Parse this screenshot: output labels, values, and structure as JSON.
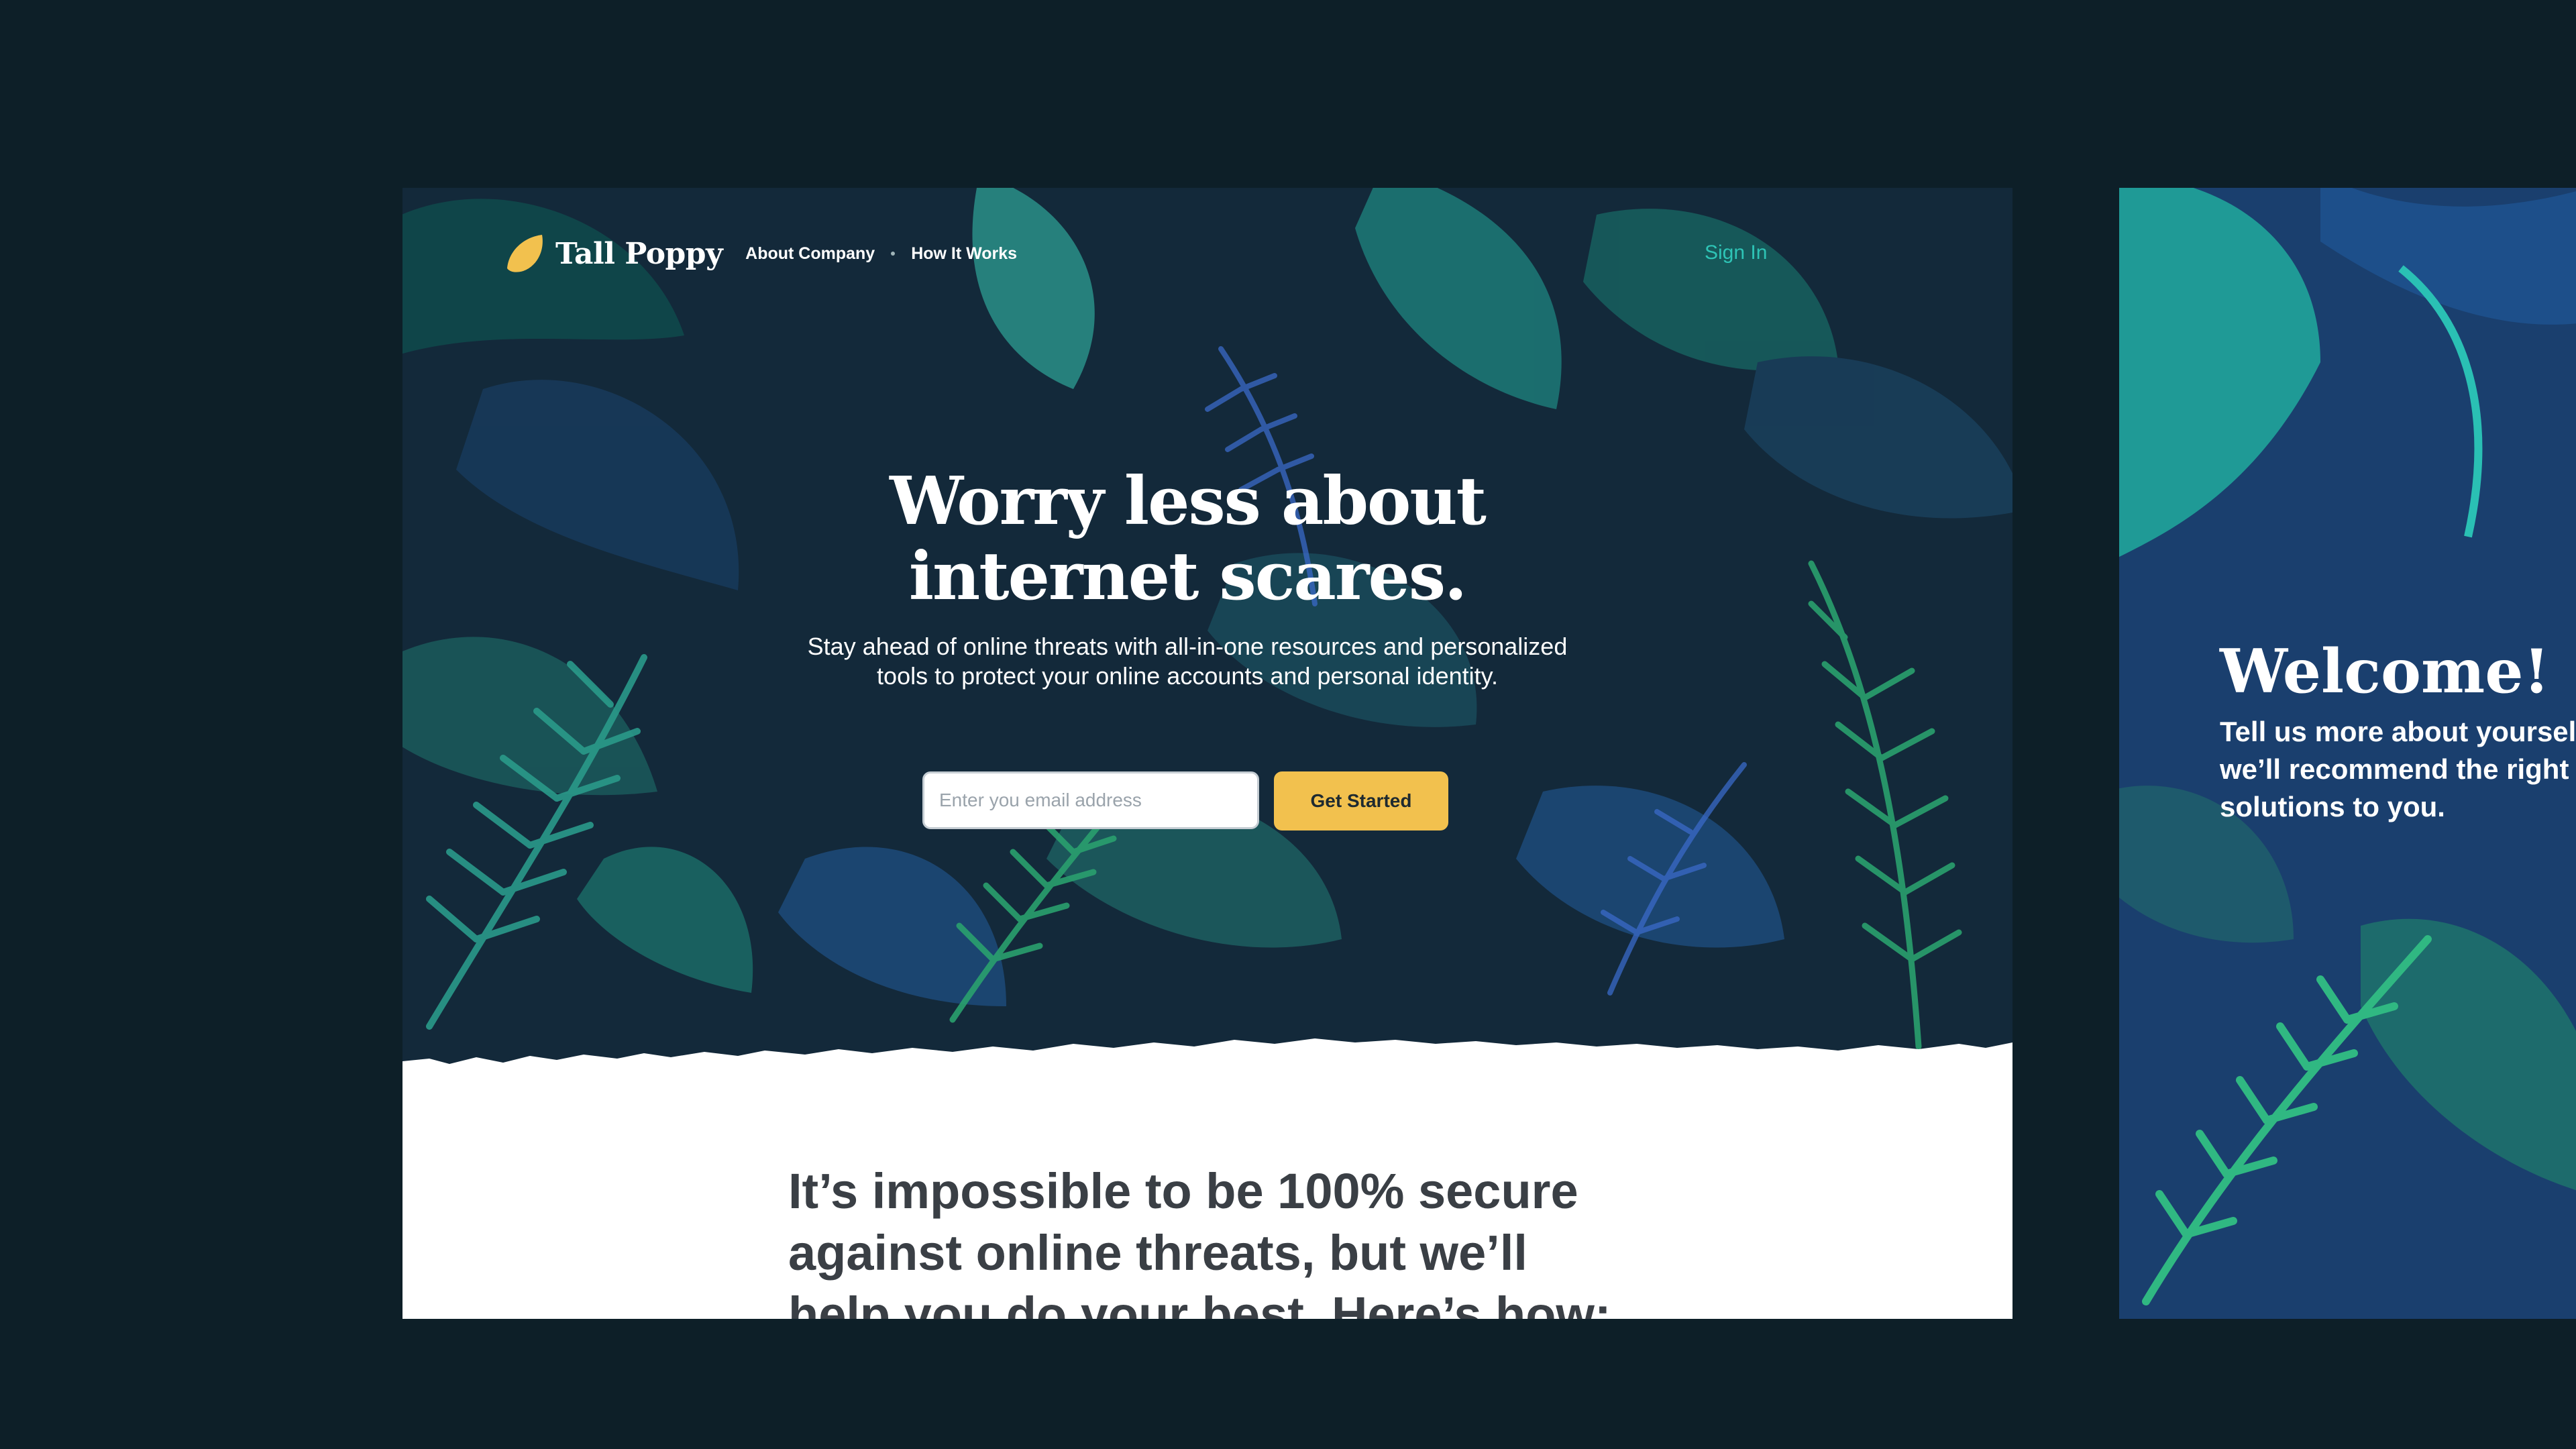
{
  "brand": {
    "name": "Tall Poppy"
  },
  "nav": {
    "links": [
      "About Company",
      "How It Works"
    ],
    "sign_in": "Sign In"
  },
  "hero": {
    "headline_lines": [
      "Worry less about",
      "internet scares."
    ],
    "subtext_lines": [
      "Stay ahead of online threats with all-in-one resources and personalized",
      "tools to protect your online accounts and personal identity."
    ],
    "email_placeholder": "Enter you email address",
    "cta_label": "Get Started"
  },
  "section": {
    "heading_lines": [
      "It’s impossible to be 100% secure",
      "against online threats, but we’ll",
      "help you do your best. Here’s how:"
    ]
  },
  "welcome": {
    "title": "Welcome!",
    "text_lines": [
      "Tell us more about yourself and",
      "we’ll recommend the right",
      "solutions to you."
    ]
  },
  "colors": {
    "background": "#0d1f28",
    "hero_bg": "#13293a",
    "accent_yellow": "#f2c14e",
    "accent_teal": "#2ec4b6",
    "heading_gray": "#3a3f45"
  }
}
